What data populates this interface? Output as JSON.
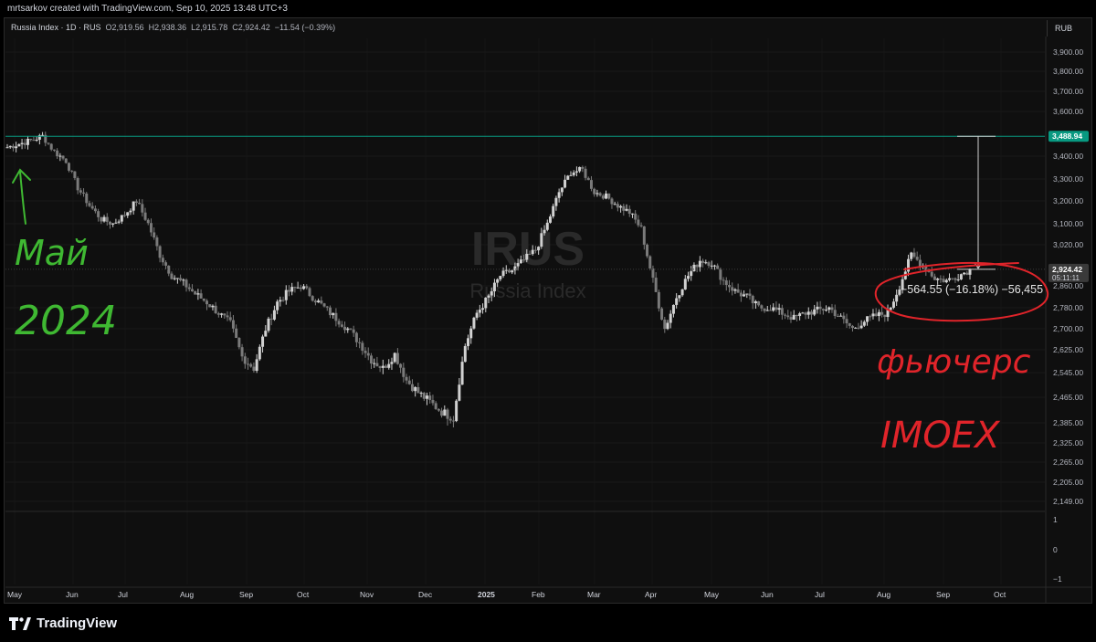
{
  "header": {
    "caption": "mrtsarkov created with TradingView.com, Sep 10, 2025 13:48 UTC+3"
  },
  "legend": {
    "symbol": "Russia Index · 1D · RUS",
    "open": "O2,919.56",
    "high": "H2,938.36",
    "low": "L2,915.78",
    "close": "C2,924.42",
    "change": "−11.54 (−0.39%)"
  },
  "currency": "RUB",
  "watermark": {
    "ticker": "IRUS",
    "name": "Russia Index"
  },
  "brand": "TradingView",
  "price_axis_labels": [
    "3,900.00",
    "3,800.00",
    "3,700.00",
    "3,600.00",
    "3,400.00",
    "3,300.00",
    "3,200.00",
    "3,100.00",
    "3,020.00",
    "2,860.00",
    "2,780.00",
    "2,700.00",
    "2,625.00",
    "2,545.00",
    "2,465.00",
    "2,385.00",
    "2,325.00",
    "2,265.00",
    "2,205.00",
    "2,149.00"
  ],
  "sub_axis_labels": [
    "1",
    "0",
    "−1"
  ],
  "time_axis_labels": [
    "May",
    "Jun",
    "Jul",
    "Aug",
    "Sep",
    "Oct",
    "Nov",
    "Dec",
    "2025",
    "Feb",
    "Mar",
    "Apr",
    "May",
    "Jun",
    "Jul",
    "Aug",
    "Sep",
    "Oct"
  ],
  "horizontal_level": {
    "value": 3488.94,
    "label": "3,488.94",
    "color": "#089981"
  },
  "last_price": {
    "value": 2924.42,
    "label": "2,924.42",
    "countdown": "05:11:11"
  },
  "measure": {
    "from": 3488.94,
    "to": 2924.42,
    "label": "−564.55 (−16.18%) −56,455"
  },
  "annotations": {
    "left_note": [
      "Май",
      "2024"
    ],
    "right_note": [
      "фьючерс",
      "IMOEX"
    ],
    "left_color": "#3fb832",
    "right_color": "#e0242a"
  },
  "chart_data": {
    "type": "candlestick",
    "title": "",
    "x_range": [
      "2024-05",
      "2025-10"
    ],
    "ylim": [
      2149,
      3900
    ],
    "grid": true,
    "approx_daily_closes_by_month": [
      {
        "month": "May 2024",
        "values": [
          3440,
          3455,
          3470,
          3490,
          3420
        ]
      },
      {
        "month": "Jun 2024",
        "values": [
          3380,
          3260,
          3180,
          3120,
          3100
        ]
      },
      {
        "month": "Jul 2024",
        "values": [
          3140,
          3200,
          3100,
          2980,
          2900
        ]
      },
      {
        "month": "Aug 2024",
        "values": [
          2870,
          2830,
          2800,
          2760,
          2720
        ]
      },
      {
        "month": "Sep 2024",
        "values": [
          2600,
          2560,
          2700,
          2800,
          2840
        ]
      },
      {
        "month": "Oct 2024",
        "values": [
          2860,
          2820,
          2780,
          2740,
          2700
        ]
      },
      {
        "month": "Nov 2024",
        "values": [
          2650,
          2590,
          2560,
          2610,
          2520
        ]
      },
      {
        "month": "Dec 2024",
        "values": [
          2480,
          2450,
          2420,
          2400,
          2640
        ]
      },
      {
        "month": "Jan 2025",
        "values": [
          2760,
          2820,
          2900,
          2920,
          2960
        ]
      },
      {
        "month": "Feb 2025",
        "values": [
          3000,
          3100,
          3240,
          3330,
          3340
        ]
      },
      {
        "month": "Mar 2025",
        "values": [
          3240,
          3220,
          3180,
          3150,
          3080
        ]
      },
      {
        "month": "Apr 2025",
        "values": [
          2880,
          2700,
          2820,
          2900,
          2960
        ]
      },
      {
        "month": "May 2025",
        "values": [
          2950,
          2880,
          2840,
          2820,
          2780
        ]
      },
      {
        "month": "Jun 2025",
        "values": [
          2780,
          2760,
          2740,
          2760,
          2770
        ]
      },
      {
        "month": "Jul 2025",
        "values": [
          2780,
          2740,
          2700,
          2730,
          2750
        ]
      },
      {
        "month": "Aug 2025",
        "values": [
          2760,
          2860,
          2980,
          2940,
          2890
        ]
      },
      {
        "month": "Sep 2025",
        "values": [
          2880,
          2900,
          2924
        ]
      }
    ]
  }
}
